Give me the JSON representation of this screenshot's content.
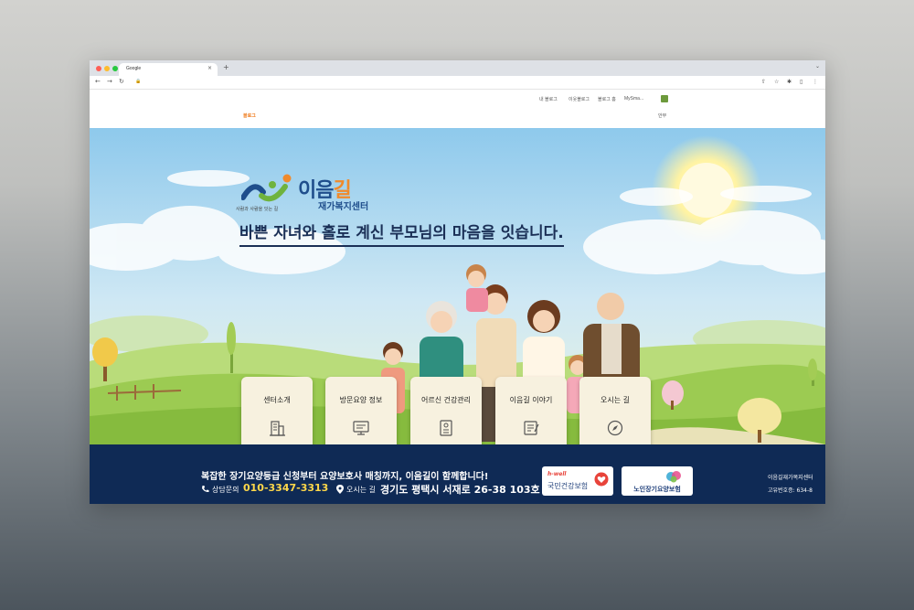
{
  "browser": {
    "tab_title": "Google",
    "tab_close": "×",
    "new_tab": "+",
    "tab_menu": "⌄",
    "nav": {
      "back": "←",
      "forward": "→",
      "reload": "↻"
    },
    "lock": "🔒",
    "toolbar_icons": [
      "⇧",
      "☆",
      "✱",
      "▯",
      "⋮"
    ]
  },
  "blog": {
    "top_links": [
      "내 블로그",
      "이웃블로그",
      "블로그 홈",
      "MySma..."
    ],
    "logo": "블로그",
    "menu": "안부"
  },
  "hero": {
    "logo_text_left": "이음",
    "logo_text_right": "길",
    "logo_subtitle": "재가복지센터",
    "logo_tagline": "사람과 사람을 잇는 길",
    "headline": "바쁜 자녀와 홀로 계신 부모님의 마음을 잇습니다."
  },
  "cards": [
    {
      "label": "센터소개",
      "icon": "building-icon"
    },
    {
      "label": "방문요양 정보",
      "icon": "monitor-icon"
    },
    {
      "label": "어르신 건강관리",
      "icon": "medical-record-icon"
    },
    {
      "label": "이음길 이야기",
      "icon": "notebook-icon"
    },
    {
      "label": "오시는 길",
      "icon": "compass-icon"
    }
  ],
  "footer": {
    "slogan": "복잡한 장기요양등급 신청부터 요양보호사 매칭까지, 이음길이 함께합니다!",
    "phone_label": "상담문의",
    "phone": "010-3347-3313",
    "address_label": "오시는 길",
    "address": "경기도 평택시 서재로 26-38 103호",
    "badge1_brand": "h-well",
    "badge1_text": "국민건강보험",
    "badge2_text": "노인장기요양보험",
    "right_line1": "이음길재가복지센터",
    "right_line2": "고유번호증: 634-8"
  },
  "colors": {
    "navy": "#0f2a55",
    "logo_blue": "#1f4e8c",
    "logo_orange": "#f08a2b",
    "phone_yellow": "#ffd84a",
    "card_bg": "#f7f1df"
  }
}
